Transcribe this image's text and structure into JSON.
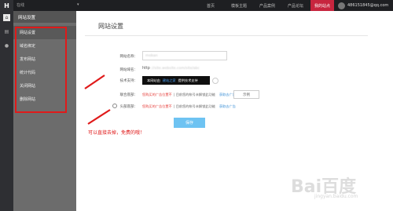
{
  "topbar": {
    "site_name": "在线",
    "nav": [
      "首页",
      "模板主题",
      "产品案例",
      "产品论坛",
      "我的站点"
    ],
    "active_nav": "我的站点",
    "user_id": "486151845@qq.com"
  },
  "rail": {
    "icons": [
      "home-icon",
      "document-icon",
      "chat-icon"
    ]
  },
  "sidebar": {
    "header": "网站设置",
    "items": [
      {
        "label": "网站设置",
        "active": true
      },
      {
        "label": "域名绑定"
      },
      {
        "label": "发布网站"
      },
      {
        "label": "统计代码"
      },
      {
        "label": "关闭网站"
      },
      {
        "label": "删除网站"
      }
    ]
  },
  "main": {
    "page_title": "网站设置",
    "site_name_label": "网站名称：",
    "site_name_value": "moban",
    "site_domain_label": "网站域名：",
    "site_domain_prefix": "http",
    "site_domain_value": "://site.website.com/site/abc",
    "tech_support_label": "技术支持：",
    "tech_support_text": "本网站由",
    "tech_support_link": "建站之家",
    "tech_support_suffix": "提供技术支持",
    "ad_top_label": "联合底部：",
    "ad_top_red": "您购买的广告位置不",
    "ad_top_gray": "| 目前您的帐号未解锁此功能",
    "ad_top_link": "获取去广告",
    "ad_top_button": "示例",
    "ad_bottom_label": "头部底部：",
    "ad_bottom_red": "您购买的广告位置不",
    "ad_bottom_gray": "| 目前您的帐号未解锁此功能",
    "ad_bottom_link": "获取去广告",
    "save_button": "保存"
  },
  "annotation": "可以直接去掉，免费的哦！",
  "watermark": {
    "main": "Bai百度",
    "sub": "jingyan.baidu.com"
  },
  "colors": {
    "accent_red": "#c7253e",
    "annotation_red": "#e01a1a",
    "save_blue": "#6ec3f2"
  }
}
